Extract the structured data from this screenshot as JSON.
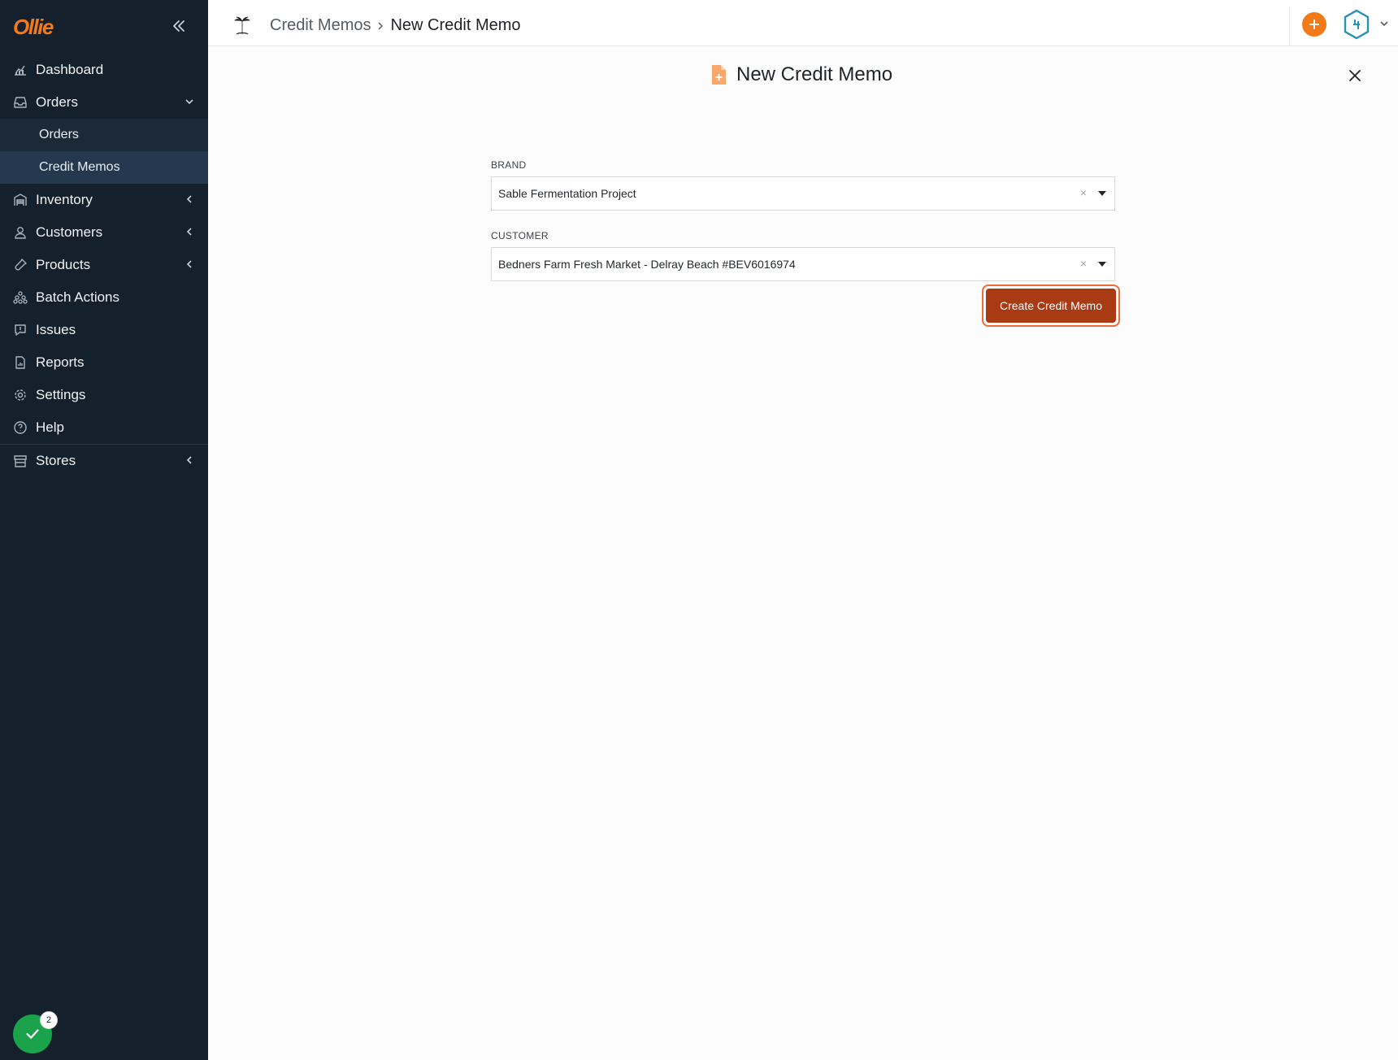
{
  "app": {
    "logo": "Ollie"
  },
  "sidebar": {
    "items": [
      {
        "label": "Dashboard",
        "icon": "chart-icon"
      },
      {
        "label": "Orders",
        "icon": "inbox-icon",
        "expanded": true,
        "children": [
          {
            "label": "Orders"
          },
          {
            "label": "Credit Memos",
            "active": true
          }
        ]
      },
      {
        "label": "Inventory",
        "icon": "warehouse-icon"
      },
      {
        "label": "Customers",
        "icon": "user-icon"
      },
      {
        "label": "Products",
        "icon": "bottle-icon"
      },
      {
        "label": "Batch Actions",
        "icon": "stack-icon"
      },
      {
        "label": "Issues",
        "icon": "alert-icon"
      },
      {
        "label": "Reports",
        "icon": "report-icon"
      },
      {
        "label": "Settings",
        "icon": "gear-icon"
      },
      {
        "label": "Help",
        "icon": "help-icon"
      },
      {
        "label": "Stores",
        "icon": "store-icon"
      }
    ],
    "status_count": "2"
  },
  "header": {
    "breadcrumb": {
      "parent": "Credit Memos",
      "current": "New Credit Memo"
    }
  },
  "main": {
    "title": "New Credit Memo",
    "brand": {
      "label": "BRAND",
      "value": "Sable Fermentation Project"
    },
    "customer": {
      "label": "CUSTOMER",
      "value": "Bedners Farm Fresh Market - Delray Beach #BEV6016974"
    },
    "submit_label": "Create Credit Memo"
  },
  "colors": {
    "accent": "#f27a1a",
    "sidebar_bg": "#14202b",
    "submit_bg": "#a83a14",
    "success": "#1aa34a"
  }
}
